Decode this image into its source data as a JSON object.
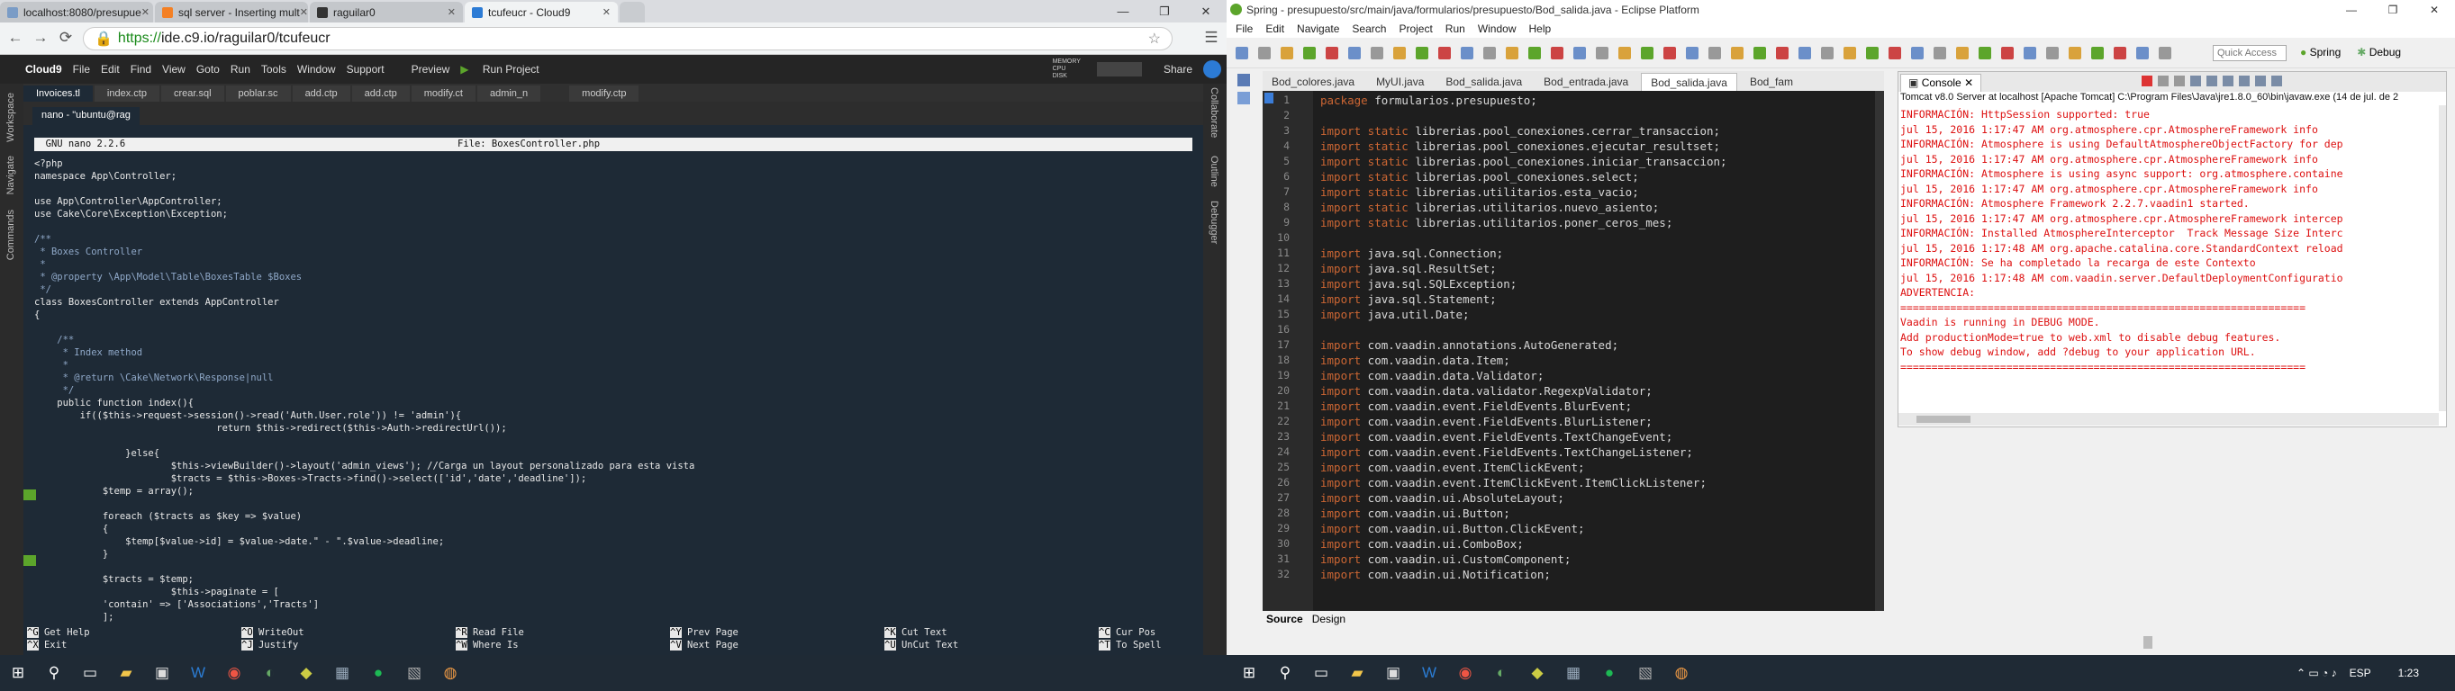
{
  "left_window": {
    "chrome_tabs": [
      {
        "title": "localhost:8080/presupue",
        "icon": "page-icon"
      },
      {
        "title": "sql server - Inserting mult",
        "icon": "stackoverflow-icon"
      },
      {
        "title": "raguilar0",
        "icon": "github-icon"
      },
      {
        "title": "tcufeucr - Cloud9",
        "icon": "cloud9-icon"
      }
    ],
    "url_scheme": "https://",
    "url_rest": "ide.c9.io/raguilar0/tcufeucr",
    "c9_menu": [
      "Cloud9",
      "File",
      "Edit",
      "Find",
      "View",
      "Goto",
      "Run",
      "Tools",
      "Window",
      "Support"
    ],
    "preview_label": "Preview",
    "run_label": "Run Project",
    "share_label": "Share",
    "memory_label": "MEMORY\nCPU\nDISK",
    "c9_tabs": [
      "Invoices.tl",
      "index.ctp",
      "crear.sql",
      "poblar.sc",
      "add.ctp",
      "add.ctp",
      "modify.ct",
      "admin_n",
      "modify.ctp"
    ],
    "left_rail": [
      "Workspace",
      "Navigate",
      "Commands"
    ],
    "right_rail": [
      "Collaborate",
      "Outline",
      "Debugger"
    ],
    "terminal_tab": "nano - \"ubuntu@rag",
    "nano_header_left": "  GNU nano 2.2.6",
    "nano_header_center": "File: BoxesController.php",
    "code": [
      "<?php",
      "namespace App\\Controller;",
      "",
      "use App\\Controller\\AppController;",
      "use Cake\\Core\\Exception\\Exception;",
      "",
      "/**",
      " * Boxes Controller",
      " *",
      " * @property \\App\\Model\\Table\\BoxesTable $Boxes",
      " */",
      "class BoxesController extends AppController",
      "{",
      "",
      "    /**",
      "     * Index method",
      "     *",
      "     * @return \\Cake\\Network\\Response|null",
      "     */",
      "    public function index(){",
      "        if(($this->request->session()->read('Auth.User.role')) != 'admin'){",
      "                                return $this->redirect($this->Auth->redirectUrl());",
      "",
      "                }else{",
      "                        $this->viewBuilder()->layout('admin_views'); //Carga un layout personalizado para esta vista",
      "                        $tracts = $this->Boxes->Tracts->find()->select(['id','date','deadline']);",
      "            $temp = array();",
      "",
      "            foreach ($tracts as $key => $value)",
      "            {",
      "                $temp[$value->id] = $value->date.\" - \".$value->deadline;",
      "            }",
      "",
      "            $tracts = $temp;",
      "                        $this->paginate = [",
      "            'contain' => ['Associations','Tracts']",
      "            ];"
    ],
    "help_keys": [
      {
        "k1": "^G",
        "l1": "Get Help",
        "k2": "^X",
        "l2": "Exit"
      },
      {
        "k1": "^O",
        "l1": "WriteOut",
        "k2": "^J",
        "l2": "Justify"
      },
      {
        "k1": "^R",
        "l1": "Read File",
        "k2": "^W",
        "l2": "Where Is"
      },
      {
        "k1": "^Y",
        "l1": "Prev Page",
        "k2": "^V",
        "l2": "Next Page"
      },
      {
        "k1": "^K",
        "l1": "Cut Text",
        "k2": "^U",
        "l2": "UnCut Text"
      },
      {
        "k1": "^C",
        "l1": "Cur Pos",
        "k2": "^T",
        "l2": "To Spell"
      }
    ]
  },
  "right_window": {
    "title": "Spring - presupuesto/src/main/java/formularios/presupuesto/Bod_salida.java - Eclipse Platform",
    "menu": [
      "File",
      "Edit",
      "Navigate",
      "Search",
      "Project",
      "Run",
      "Window",
      "Help"
    ],
    "quick_access": "Quick Access",
    "perspectives": [
      "Spring",
      "Debug"
    ],
    "editor_tabs": [
      "Bod_colores.java",
      "MyUI.java",
      "Bod_salida.java",
      "Bod_entrada.java",
      "Bod_salida.java",
      "Bod_fam"
    ],
    "active_editor_tab": 4,
    "code_lines": [
      {
        "n": "1",
        "t": "package formularios.presupuesto;"
      },
      {
        "n": "2",
        "t": ""
      },
      {
        "n": "3",
        "t": "import static librerias.pool_conexiones.cerrar_transaccion;"
      },
      {
        "n": "4",
        "t": "import static librerias.pool_conexiones.ejecutar_resultset;"
      },
      {
        "n": "5",
        "t": "import static librerias.pool_conexiones.iniciar_transaccion;"
      },
      {
        "n": "6",
        "t": "import static librerias.pool_conexiones.select;"
      },
      {
        "n": "7",
        "t": "import static librerias.utilitarios.esta_vacio;"
      },
      {
        "n": "8",
        "t": "import static librerias.utilitarios.nuevo_asiento;"
      },
      {
        "n": "9",
        "t": "import static librerias.utilitarios.poner_ceros_mes;"
      },
      {
        "n": "10",
        "t": ""
      },
      {
        "n": "11",
        "t": "import java.sql.Connection;"
      },
      {
        "n": "12",
        "t": "import java.sql.ResultSet;"
      },
      {
        "n": "13",
        "t": "import java.sql.SQLException;"
      },
      {
        "n": "14",
        "t": "import java.sql.Statement;"
      },
      {
        "n": "15",
        "t": "import java.util.Date;"
      },
      {
        "n": "16",
        "t": ""
      },
      {
        "n": "17",
        "t": "import com.vaadin.annotations.AutoGenerated;"
      },
      {
        "n": "18",
        "t": "import com.vaadin.data.Item;"
      },
      {
        "n": "19",
        "t": "import com.vaadin.data.Validator;"
      },
      {
        "n": "20",
        "t": "import com.vaadin.data.validator.RegexpValidator;"
      },
      {
        "n": "21",
        "t": "import com.vaadin.event.FieldEvents.BlurEvent;"
      },
      {
        "n": "22",
        "t": "import com.vaadin.event.FieldEvents.BlurListener;"
      },
      {
        "n": "23",
        "t": "import com.vaadin.event.FieldEvents.TextChangeEvent;"
      },
      {
        "n": "24",
        "t": "import com.vaadin.event.FieldEvents.TextChangeListener;"
      },
      {
        "n": "25",
        "t": "import com.vaadin.event.ItemClickEvent;"
      },
      {
        "n": "26",
        "t": "import com.vaadin.event.ItemClickEvent.ItemClickListener;"
      },
      {
        "n": "27",
        "t": "import com.vaadin.ui.AbsoluteLayout;"
      },
      {
        "n": "28",
        "t": "import com.vaadin.ui.Button;"
      },
      {
        "n": "29",
        "t": "import com.vaadin.ui.Button.ClickEvent;"
      },
      {
        "n": "30",
        "t": "import com.vaadin.ui.ComboBox;"
      },
      {
        "n": "31",
        "t": "import com.vaadin.ui.CustomComponent;"
      },
      {
        "n": "32",
        "t": "import com.vaadin.ui.Notification;"
      }
    ],
    "console_tab": "Console",
    "console_path": "Tomcat v8.0 Server at localhost [Apache Tomcat] C:\\Program Files\\Java\\jre1.8.0_60\\bin\\javaw.exe (14 de jul. de 2",
    "console_lines": [
      "INFORMACIÓN: HttpSession supported: true",
      "jul 15, 2016 1:17:47 AM org.atmosphere.cpr.AtmosphereFramework info",
      "INFORMACIÓN: Atmosphere is using DefaultAtmosphereObjectFactory for dep",
      "jul 15, 2016 1:17:47 AM org.atmosphere.cpr.AtmosphereFramework info",
      "INFORMACIÓN: Atmosphere is using async support: org.atmosphere.containe",
      "jul 15, 2016 1:17:47 AM org.atmosphere.cpr.AtmosphereFramework info",
      "INFORMACIÓN: Atmosphere Framework 2.2.7.vaadin1 started.",
      "jul 15, 2016 1:17:47 AM org.atmosphere.cpr.AtmosphereFramework intercep",
      "INFORMACIÓN: Installed AtmosphereInterceptor  Track Message Size Interc",
      "jul 15, 2016 1:17:48 AM org.apache.catalina.core.StandardContext reload",
      "INFORMACIÓN: Se ha completado la recarga de este Contexto",
      "jul 15, 2016 1:17:48 AM com.vaadin.server.DefaultDeploymentConfiguratio",
      "ADVERTENCIA:",
      "=================================================================",
      "Vaadin is running in DEBUG MODE.",
      "Add productionMode=true to web.xml to disable debug features.",
      "To show debug window, add ?debug to your application URL.",
      "================================================================="
    ],
    "source_tabs": [
      "Source",
      "Design"
    ],
    "clock": "1:23",
    "lang": "ESP"
  },
  "colors": {
    "accent_green": "#5ca52b",
    "java_keyword": "#cc6633",
    "console_error": "#dd1111"
  }
}
